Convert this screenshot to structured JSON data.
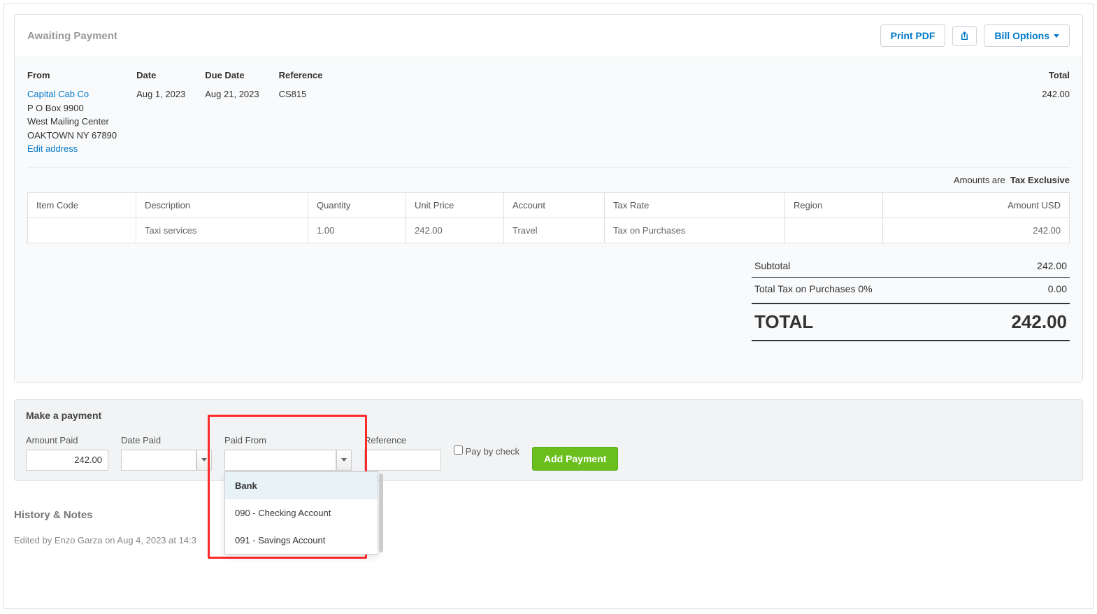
{
  "header": {
    "status": "Awaiting Payment",
    "print_label": "Print PDF",
    "options_label": "Bill Options"
  },
  "from": {
    "label": "From",
    "name": "Capital Cab Co",
    "addr1": "P O Box 9900",
    "addr2": "West Mailing Center",
    "addr3": "OAKTOWN NY 67890",
    "edit_link": "Edit address"
  },
  "meta": {
    "date_label": "Date",
    "date_value": "Aug 1, 2023",
    "due_label": "Due Date",
    "due_value": "Aug 21, 2023",
    "ref_label": "Reference",
    "ref_value": "CS815",
    "total_label": "Total",
    "total_value": "242.00"
  },
  "amounts_note_prefix": "Amounts are",
  "amounts_note_bold": "Tax Exclusive",
  "table": {
    "headers": {
      "item_code": "Item Code",
      "description": "Description",
      "quantity": "Quantity",
      "unit_price": "Unit Price",
      "account": "Account",
      "tax_rate": "Tax Rate",
      "region": "Region",
      "amount": "Amount USD"
    },
    "row": {
      "item_code": "",
      "description": "Taxi services",
      "quantity": "1.00",
      "unit_price": "242.00",
      "account": "Travel",
      "tax_rate": "Tax on Purchases",
      "region": "",
      "amount": "242.00"
    }
  },
  "totals": {
    "subtotal_label": "Subtotal",
    "subtotal_value": "242.00",
    "tax_label": "Total Tax on Purchases 0%",
    "tax_value": "0.00",
    "grand_label": "TOTAL",
    "grand_value": "242.00"
  },
  "payment": {
    "title": "Make a payment",
    "amount_label": "Amount Paid",
    "amount_value": "242.00",
    "date_label": "Date Paid",
    "date_value": "",
    "paid_from_label": "Paid From",
    "paid_from_value": "",
    "reference_label": "Reference",
    "reference_value": "",
    "check_label": "Pay by check",
    "add_label": "Add Payment",
    "dropdown": {
      "category": "Bank",
      "option1": "090 - Checking Account",
      "option2": "091 - Savings Account"
    }
  },
  "history": {
    "title": "History & Notes",
    "entry": "Edited by Enzo Garza on Aug 4, 2023 at 14:3"
  }
}
